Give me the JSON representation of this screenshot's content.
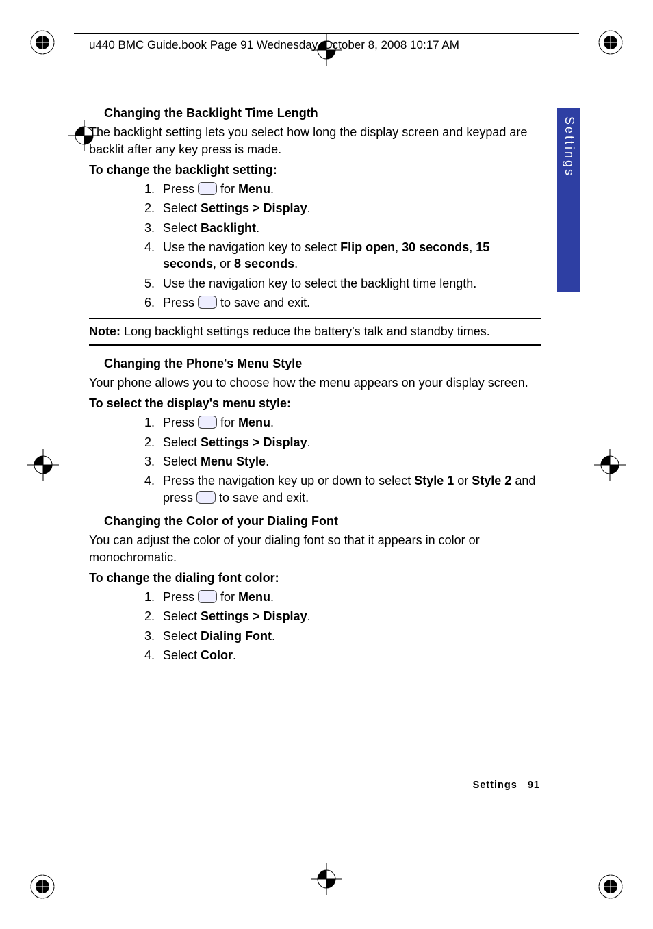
{
  "header": {
    "running": "u440 BMC Guide.book  Page 91  Wednesday, October 8, 2008  10:17 AM"
  },
  "sideTab": "Settings",
  "footer": {
    "section": "Settings",
    "page": "91"
  },
  "sections": {
    "backlight": {
      "title": "Changing the Backlight Time Length",
      "intro": "The backlight setting lets you select how long the display screen and keypad are backlit after any key press is made.",
      "procTitle": "To change the backlight setting:",
      "steps": {
        "s1a": "Press ",
        "s1b": " for ",
        "s1c": "Menu",
        "s1d": ".",
        "s2a": "Select ",
        "s2b": "Settings > Display",
        "s2c": ".",
        "s3a": "Select ",
        "s3b": "Backlight",
        "s3c": ".",
        "s4a": "Use the navigation key to select ",
        "s4b": "Flip open",
        "s4c": ", ",
        "s4d": "30 seconds",
        "s4e": ", ",
        "s4f": "15 seconds",
        "s4g": ", or ",
        "s4h": "8 seconds",
        "s4i": ".",
        "s5": "Use the navigation key to select the backlight time length.",
        "s6a": "Press ",
        "s6b": " to save and exit."
      },
      "noteLabel": "Note:",
      "noteText": " Long backlight settings reduce the battery's talk and standby times."
    },
    "menuStyle": {
      "title": "Changing the Phone's Menu Style",
      "intro": "Your phone allows you to choose how the menu appears on your display screen.",
      "procTitle": "To select the display's menu style:",
      "steps": {
        "s1a": "Press ",
        "s1b": " for ",
        "s1c": "Menu",
        "s1d": ".",
        "s2a": "Select ",
        "s2b": "Settings > Display",
        "s2c": ".",
        "s3a": "Select ",
        "s3b": "Menu Style",
        "s3c": ".",
        "s4a": "Press the navigation key up or down to select ",
        "s4b": "Style 1",
        "s4c": " or ",
        "s4d": "Style 2",
        "s4e": " and press ",
        "s4f": " to save and exit."
      }
    },
    "dialColor": {
      "title": "Changing the Color of your Dialing Font",
      "intro": "You can adjust the color of your dialing font so that it appears in color or monochromatic.",
      "procTitle": "To change the dialing font color:",
      "steps": {
        "s1a": "Press ",
        "s1b": " for ",
        "s1c": "Menu",
        "s1d": ".",
        "s2a": "Select ",
        "s2b": "Settings > Display",
        "s2c": ".",
        "s3a": "Select ",
        "s3b": "Dialing Font",
        "s3c": ".",
        "s4a": "Select ",
        "s4b": "Color",
        "s4c": "."
      }
    }
  }
}
